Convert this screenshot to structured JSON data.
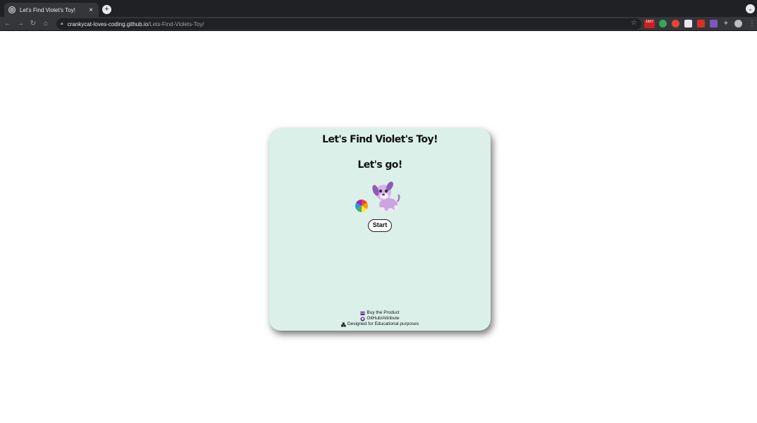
{
  "browser": {
    "tab_title": "Let's Find Violet's Toy!",
    "tab_close": "×",
    "new_tab": "+",
    "tab_menu": "⌄",
    "url_host": "crankycat-loves-coding.github.io",
    "url_path": "/Lets-Find-Violets-Toy/",
    "ext_badge_text": "1607",
    "colors": {
      "frame": "#202124",
      "toolbar": "#35363a"
    }
  },
  "game": {
    "title": "Let's Find Violet's Toy!",
    "status": "Let's go!",
    "start_label": "Start",
    "card_color": "#dcf0ea"
  },
  "footer": {
    "buy_label": "Buy the Product",
    "github_label": "GitHub/Attribute",
    "designed_label": "Designed for Educational purposes"
  }
}
